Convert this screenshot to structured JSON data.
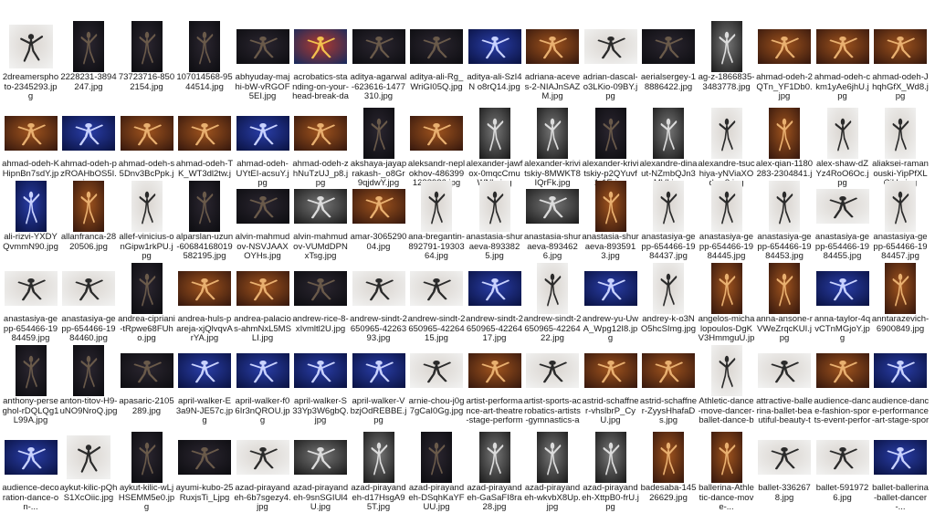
{
  "files": [
    {
      "name": "2dreamersphoto-2345293.jpg",
      "icon": "photo-thumbnail-icon",
      "tone": "light",
      "shape": "sq"
    },
    {
      "name": "2228231-3894247.jpg",
      "icon": "photo-thumbnail-icon",
      "tone": "dark",
      "shape": "port"
    },
    {
      "name": "73723716-8502154.jpg",
      "icon": "photo-thumbnail-icon",
      "tone": "dark",
      "shape": "port"
    },
    {
      "name": "107014568-9544514.jpg",
      "icon": "photo-thumbnail-icon",
      "tone": "dark",
      "shape": "port"
    },
    {
      "name": "abhyuday-majhi-bW-vRGOF5EI.jpg",
      "icon": "photo-thumbnail-icon",
      "tone": "dark",
      "shape": "land"
    },
    {
      "name": "acrobatics-standing-on-your-head-break-dancing-physical-...",
      "icon": "photo-thumbnail-icon",
      "tone": "color",
      "shape": "land"
    },
    {
      "name": "aditya-agarwal-623616-1477310.jpg",
      "icon": "photo-thumbnail-icon",
      "tone": "dark",
      "shape": "land"
    },
    {
      "name": "aditya-ali-Rg_WriGI05Q.jpg",
      "icon": "photo-thumbnail-icon",
      "tone": "dark",
      "shape": "land"
    },
    {
      "name": "aditya-ali-SzI4N o8rQ14.jpg",
      "icon": "photo-thumbnail-icon",
      "tone": "blue",
      "shape": "land"
    },
    {
      "name": "adriana-aceves-2-NIAJnSAZM.jpg",
      "icon": "photo-thumbnail-icon",
      "tone": "warm",
      "shape": "land"
    },
    {
      "name": "adrian-dascal-o3LKio-09BY.jpg",
      "icon": "photo-thumbnail-icon",
      "tone": "light",
      "shape": "land"
    },
    {
      "name": "aerialsergey-18886422.jpg",
      "icon": "photo-thumbnail-icon",
      "tone": "dark",
      "shape": "land"
    },
    {
      "name": "ag-z-1866835-3483778.jpg",
      "icon": "photo-thumbnail-icon",
      "tone": "gray",
      "shape": "port"
    },
    {
      "name": "ahmad-odeh-2QTn_YF1Db0.jpg",
      "icon": "photo-thumbnail-icon",
      "tone": "warm",
      "shape": "land"
    },
    {
      "name": "ahmad-odeh-ckm1yAe6jhU.jpg",
      "icon": "photo-thumbnail-icon",
      "tone": "warm",
      "shape": "land"
    },
    {
      "name": "ahmad-odeh-JhqhGfX_Wd8.jpg",
      "icon": "photo-thumbnail-icon",
      "tone": "warm",
      "shape": "land"
    },
    {
      "name": "ahmad-odeh-KHipnBn7sdY.jpg",
      "icon": "photo-thumbnail-icon",
      "tone": "warm",
      "shape": "land"
    },
    {
      "name": "ahmad-odeh-pzROAHbOS5I.jpg",
      "icon": "photo-thumbnail-icon",
      "tone": "blue",
      "shape": "land"
    },
    {
      "name": "ahmad-odeh-s5Dnv3BcPpk.jpg",
      "icon": "photo-thumbnail-icon",
      "tone": "warm",
      "shape": "land"
    },
    {
      "name": "ahmad-odeh-TK_WT3dl2tw.jpg",
      "icon": "photo-thumbnail-icon",
      "tone": "warm",
      "shape": "land"
    },
    {
      "name": "ahmad-odeh-UYtEI-acsuY.jpg",
      "icon": "photo-thumbnail-icon",
      "tone": "blue",
      "shape": "land"
    },
    {
      "name": "ahmad-odeh-zhNuTzUJ_p8.jpg",
      "icon": "photo-thumbnail-icon",
      "tone": "warm",
      "shape": "land"
    },
    {
      "name": "akshaya-jayaprakash-_o8Gr9qjdwY.jpg",
      "icon": "photo-thumbnail-icon",
      "tone": "dark",
      "shape": "port"
    },
    {
      "name": "aleksandr-neplokhov-4863991238986.jpg",
      "icon": "photo-thumbnail-icon",
      "tone": "warm",
      "shape": "land"
    },
    {
      "name": "alexander-jawfox-0mqcCmuWNlc.jpg",
      "icon": "photo-thumbnail-icon",
      "tone": "gray",
      "shape": "port"
    },
    {
      "name": "alexander-krivitskiy-8MWKT8IQrFk.jpg",
      "icon": "photo-thumbnail-icon",
      "tone": "gray",
      "shape": "port"
    },
    {
      "name": "alexander-krivitskiy-p2QYuvf1-1E.jpg",
      "icon": "photo-thumbnail-icon",
      "tone": "dark",
      "shape": "port"
    },
    {
      "name": "alexandre-dinaut-NZmbQJn3MVI.jpg",
      "icon": "photo-thumbnail-icon",
      "tone": "gray",
      "shape": "port"
    },
    {
      "name": "alexandre-tsuchiya-yNViaXOdwp8.jpg",
      "icon": "photo-thumbnail-icon",
      "tone": "light",
      "shape": "port"
    },
    {
      "name": "alex-qian-1180283-2304841.jpg",
      "icon": "photo-thumbnail-icon",
      "tone": "warm",
      "shape": "port"
    },
    {
      "name": "alex-shaw-dZYz4RoO6Oc.jpg",
      "icon": "photo-thumbnail-icon",
      "tone": "light",
      "shape": "port"
    },
    {
      "name": "aliaksei-ramanouski-YipPfXLCiUo.jpg",
      "icon": "photo-thumbnail-icon",
      "tone": "light",
      "shape": "port"
    },
    {
      "name": "ali-rizvi-YXDYQvmmN90.jpg",
      "icon": "photo-thumbnail-icon",
      "tone": "blue",
      "shape": "port"
    },
    {
      "name": "allanfranca-2820506.jpg",
      "icon": "photo-thumbnail-icon",
      "tone": "warm",
      "shape": "port"
    },
    {
      "name": "allef-vinicius-onGipw1rkPU.jpg",
      "icon": "photo-thumbnail-icon",
      "tone": "light",
      "shape": "port"
    },
    {
      "name": "alparslan-uzun-60684168019582195.jpg",
      "icon": "photo-thumbnail-icon",
      "tone": "dark",
      "shape": "port"
    },
    {
      "name": "alvin-mahmudov-NSVJAAXOYHs.jpg",
      "icon": "photo-thumbnail-icon",
      "tone": "dark",
      "shape": "land"
    },
    {
      "name": "alvin-mahmudov-VUMdDPNxTsg.jpg",
      "icon": "photo-thumbnail-icon",
      "tone": "gray",
      "shape": "land"
    },
    {
      "name": "amar-306529004.jpg",
      "icon": "photo-thumbnail-icon",
      "tone": "warm",
      "shape": "land"
    },
    {
      "name": "ana-bregantin-892791-1930364.jpg",
      "icon": "photo-thumbnail-icon",
      "tone": "light",
      "shape": "port"
    },
    {
      "name": "anastasia-shuraeva-8933825.jpg",
      "icon": "photo-thumbnail-icon",
      "tone": "light",
      "shape": "port"
    },
    {
      "name": "anastasia-shuraeva-8934626.jpg",
      "icon": "photo-thumbnail-icon",
      "tone": "gray",
      "shape": "land"
    },
    {
      "name": "anastasia-shuraeva-8935913.jpg",
      "icon": "photo-thumbnail-icon",
      "tone": "warm",
      "shape": "port"
    },
    {
      "name": "anastasiya-gepp-654466-1984437.jpg",
      "icon": "photo-thumbnail-icon",
      "tone": "light",
      "shape": "port"
    },
    {
      "name": "anastasiya-gepp-654466-1984445.jpg",
      "icon": "photo-thumbnail-icon",
      "tone": "light",
      "shape": "port"
    },
    {
      "name": "anastasiya-gepp-654466-1984453.jpg",
      "icon": "photo-thumbnail-icon",
      "tone": "light",
      "shape": "port"
    },
    {
      "name": "anastasiya-gepp-654466-1984455.jpg",
      "icon": "photo-thumbnail-icon",
      "tone": "light",
      "shape": "land"
    },
    {
      "name": "anastasiya-gepp-654466-1984457.jpg",
      "icon": "photo-thumbnail-icon",
      "tone": "light",
      "shape": "port"
    },
    {
      "name": "anastasiya-gepp-654466-1984459.jpg",
      "icon": "photo-thumbnail-icon",
      "tone": "light",
      "shape": "land"
    },
    {
      "name": "anastasiya-gepp-654466-1984460.jpg",
      "icon": "photo-thumbnail-icon",
      "tone": "light",
      "shape": "land"
    },
    {
      "name": "andrea-cipriani-tRpwe68FUho.jpg",
      "icon": "photo-thumbnail-icon",
      "tone": "dark",
      "shape": "port"
    },
    {
      "name": "andrea-huls-pareja-xjQlvqvArYA.jpg",
      "icon": "photo-thumbnail-icon",
      "tone": "warm",
      "shape": "land"
    },
    {
      "name": "andrea-palacios-ahmNxL5MSLI.jpg",
      "icon": "photo-thumbnail-icon",
      "tone": "warm",
      "shape": "land"
    },
    {
      "name": "andrew-rice-8-xIvmltl2U.jpg",
      "icon": "photo-thumbnail-icon",
      "tone": "dark",
      "shape": "land"
    },
    {
      "name": "andrew-sindt-2650965-4226393.jpg",
      "icon": "photo-thumbnail-icon",
      "tone": "light",
      "shape": "land"
    },
    {
      "name": "andrew-sindt-2650965-4226415.jpg",
      "icon": "photo-thumbnail-icon",
      "tone": "light",
      "shape": "land"
    },
    {
      "name": "andrew-sindt-2650965-4226417.jpg",
      "icon": "photo-thumbnail-icon",
      "tone": "blue",
      "shape": "land"
    },
    {
      "name": "andrew-sindt-2650965-4226422.jpg",
      "icon": "photo-thumbnail-icon",
      "tone": "light",
      "shape": "port"
    },
    {
      "name": "andrew-yu-UwA_Wpg12I8.jpg",
      "icon": "photo-thumbnail-icon",
      "tone": "blue",
      "shape": "land"
    },
    {
      "name": "andrey-k-o3NO5hcSImg.jpg",
      "icon": "photo-thumbnail-icon",
      "tone": "light",
      "shape": "port"
    },
    {
      "name": "angelos-michalopoulos-DgKV3HmmguU.jpg",
      "icon": "photo-thumbnail-icon",
      "tone": "warm",
      "shape": "port"
    },
    {
      "name": "anna-ansone-rVWeZrqcKUI.jpg",
      "icon": "photo-thumbnail-icon",
      "tone": "warm",
      "shape": "port"
    },
    {
      "name": "anna-taylor-4qvCTnMGjoY.jpg",
      "icon": "photo-thumbnail-icon",
      "tone": "blue",
      "shape": "land"
    },
    {
      "name": "anntarazevich-6900849.jpg",
      "icon": "photo-thumbnail-icon",
      "tone": "warm",
      "shape": "port"
    },
    {
      "name": "anthony-perseghol-rDQLQg1L99A.jpg",
      "icon": "photo-thumbnail-icon",
      "tone": "dark",
      "shape": "port"
    },
    {
      "name": "anton-titov-H9-uNO9NroQ.jpg",
      "icon": "photo-thumbnail-icon",
      "tone": "dark",
      "shape": "port"
    },
    {
      "name": "apasaric-2105289.jpg",
      "icon": "photo-thumbnail-icon",
      "tone": "dark",
      "shape": "land"
    },
    {
      "name": "april-walker-E3a9N-JE57c.jpg",
      "icon": "photo-thumbnail-icon",
      "tone": "blue",
      "shape": "land"
    },
    {
      "name": "april-walker-f06Ir3nQROU.jpg",
      "icon": "photo-thumbnail-icon",
      "tone": "blue",
      "shape": "land"
    },
    {
      "name": "april-walker-S33Yp3W6gbQ.jpg",
      "icon": "photo-thumbnail-icon",
      "tone": "blue",
      "shape": "land"
    },
    {
      "name": "april-walker-VbzjOdREBBE.jpg",
      "icon": "photo-thumbnail-icon",
      "tone": "blue",
      "shape": "land"
    },
    {
      "name": "arnie-chou-j0g7gCaI0Gg.jpg",
      "icon": "photo-thumbnail-icon",
      "tone": "light",
      "shape": "land"
    },
    {
      "name": "artist-performance-art-theatre-stage-performance-event-830...",
      "icon": "photo-thumbnail-icon",
      "tone": "warm",
      "shape": "land"
    },
    {
      "name": "artist-sports-acrobatics-artists-gymnastics-acrobats-132341...",
      "icon": "photo-thumbnail-icon",
      "tone": "light",
      "shape": "land"
    },
    {
      "name": "astrid-schaffner-vhslbrP_CyU.jpg",
      "icon": "photo-thumbnail-icon",
      "tone": "warm",
      "shape": "land"
    },
    {
      "name": "astrid-schaffner-ZyysHhafaDs.jpg",
      "icon": "photo-thumbnail-icon",
      "tone": "warm",
      "shape": "land"
    },
    {
      "name": "Athletic-dance-move-dancer-ballet-dance-ballet-dancer-per...",
      "icon": "photo-thumbnail-icon",
      "tone": "light",
      "shape": "port"
    },
    {
      "name": "attractive-ballerina-ballet-beautiful-beauty-two-1622688.jpg",
      "icon": "photo-thumbnail-icon",
      "tone": "light",
      "shape": "land"
    },
    {
      "name": "audience-dance-fashion-sports-event-performing-arts-10370...",
      "icon": "photo-thumbnail-icon",
      "tone": "warm",
      "shape": "land"
    },
    {
      "name": "audience-dance-performance-art-stage-sports-performance...",
      "icon": "photo-thumbnail-icon",
      "tone": "blue",
      "shape": "land"
    },
    {
      "name": "audience-decoration-dance-on-...",
      "icon": "photo-thumbnail-icon",
      "tone": "blue",
      "shape": "land"
    },
    {
      "name": "aykut-kilic-pQhS1XcOiic.jpg",
      "icon": "photo-thumbnail-icon",
      "tone": "light",
      "shape": "sq"
    },
    {
      "name": "aykut-kilic-wLjHSEMM5e0.jpg",
      "icon": "photo-thumbnail-icon",
      "tone": "dark",
      "shape": "port"
    },
    {
      "name": "ayumi-kubo-25RuxjsTi_Ljpg",
      "icon": "photo-thumbnail-icon",
      "tone": "dark",
      "shape": "land"
    },
    {
      "name": "azad-pirayandeh-6b7sgezy4.jpg",
      "icon": "photo-thumbnail-icon",
      "tone": "light",
      "shape": "land"
    },
    {
      "name": "azad-pirayandeh-9snSGIUl4U.jpg",
      "icon": "photo-thumbnail-icon",
      "tone": "gray",
      "shape": "land"
    },
    {
      "name": "azad-pirayandeh-d17HsgA95T.jpg",
      "icon": "photo-thumbnail-icon",
      "tone": "gray",
      "shape": "port"
    },
    {
      "name": "azad-pirayandeh-DSqhKaYFUU.jpg",
      "icon": "photo-thumbnail-icon",
      "tone": "dark",
      "shape": "port"
    },
    {
      "name": "azad-pirayandeh-GaSaFI8ra28.jpg",
      "icon": "photo-thumbnail-icon",
      "tone": "gray",
      "shape": "port"
    },
    {
      "name": "azad-pirayandeh-wkvbX8Up.jpg",
      "icon": "photo-thumbnail-icon",
      "tone": "gray",
      "shape": "port"
    },
    {
      "name": "azad-pirayandeh-XttpB0-frU.jpg",
      "icon": "photo-thumbnail-icon",
      "tone": "gray",
      "shape": "port"
    },
    {
      "name": "badesaba-14526629.jpg",
      "icon": "photo-thumbnail-icon",
      "tone": "warm",
      "shape": "port"
    },
    {
      "name": "ballerina-Athletic-dance-move-...",
      "icon": "photo-thumbnail-icon",
      "tone": "warm",
      "shape": "port"
    },
    {
      "name": "ballet-3362678.jpg",
      "icon": "photo-thumbnail-icon",
      "tone": "light",
      "shape": "land"
    },
    {
      "name": "ballet-5919726.jpg",
      "icon": "photo-thumbnail-icon",
      "tone": "light",
      "shape": "land"
    },
    {
      "name": "ballet-ballerina-ballet-dancer-...",
      "icon": "photo-thumbnail-icon",
      "tone": "blue",
      "shape": "land"
    }
  ],
  "tones": {
    "dark": [
      "#0e0e12",
      "#2b2630",
      "#6a5a4a"
    ],
    "light": [
      "#f1f1f0",
      "#d9d4cf",
      "#2a2a2a"
    ],
    "warm": [
      "#3a1a0e",
      "#a0541e",
      "#e9b070"
    ],
    "blue": [
      "#0b1446",
      "#2a3ea8",
      "#c9d2ff"
    ],
    "gray": [
      "#1e1e1e",
      "#777777",
      "#dcdcdc"
    ],
    "color": [
      "#1c2a5a",
      "#b23a2e",
      "#f2c14e"
    ]
  }
}
